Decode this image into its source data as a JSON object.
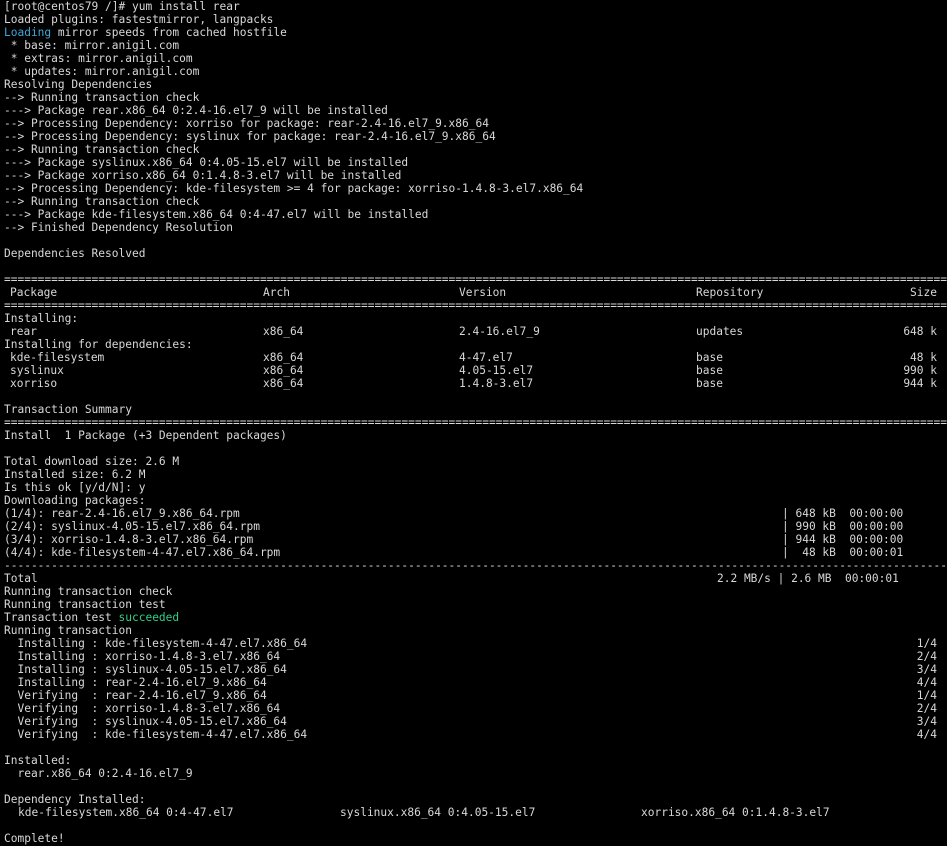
{
  "terminal": {
    "prompt": "[root@centos79 /]# yum install rear",
    "pre_lines": [
      "Loaded plugins: fastestmirror, langpacks"
    ],
    "loading_word": "Loading",
    "loading_rest": " mirror speeds from cached hostfile",
    "resolve_lines": [
      " * base: mirror.anigil.com",
      " * extras: mirror.anigil.com",
      " * updates: mirror.anigil.com",
      "Resolving Dependencies",
      "--> Running transaction check",
      "---> Package rear.x86_64 0:2.4-16.el7_9 will be installed",
      "--> Processing Dependency: xorriso for package: rear-2.4-16.el7_9.x86_64",
      "--> Processing Dependency: syslinux for package: rear-2.4-16.el7_9.x86_64",
      "--> Running transaction check",
      "---> Package syslinux.x86_64 0:4.05-15.el7 will be installed",
      "---> Package xorriso.x86_64 0:1.4.8-3.el7 will be installed",
      "--> Processing Dependency: kde-filesystem >= 4 for package: xorriso-1.4.8-3.el7.x86_64",
      "--> Running transaction check",
      "---> Package kde-filesystem.x86_64 0:4-47.el7 will be installed",
      "--> Finished Dependency Resolution",
      "",
      "Dependencies Resolved",
      ""
    ],
    "table_headers": {
      "package": "Package",
      "arch": "Arch",
      "version": "Version",
      "repository": "Repository",
      "size": "Size"
    },
    "installing_label": "Installing:",
    "installing_rows": [
      {
        "package": "rear",
        "arch": "x86_64",
        "version": "2.4-16.el7_9",
        "repository": "updates",
        "size": "648 k"
      }
    ],
    "deps_label": "Installing for dependencies:",
    "dep_rows": [
      {
        "package": "kde-filesystem",
        "arch": "x86_64",
        "version": "4-47.el7",
        "repository": "base",
        "size": "48 k"
      },
      {
        "package": "syslinux",
        "arch": "x86_64",
        "version": "4.05-15.el7",
        "repository": "base",
        "size": "990 k"
      },
      {
        "package": "xorriso",
        "arch": "x86_64",
        "version": "1.4.8-3.el7",
        "repository": "base",
        "size": "944 k"
      }
    ],
    "summary_title": "Transaction Summary",
    "summary_install": "Install  1 Package (+3 Dependent packages)",
    "totals_lines": [
      "",
      "Total download size: 2.6 M",
      "Installed size: 6.2 M",
      "Is this ok [y/d/N]: y",
      "Downloading packages:"
    ],
    "downloads": [
      {
        "name": "(1/4): rear-2.4-16.el7_9.x86_64.rpm",
        "stats": "| 648 kB  00:00:00"
      },
      {
        "name": "(2/4): syslinux-4.05-15.el7.x86_64.rpm",
        "stats": "| 990 kB  00:00:00"
      },
      {
        "name": "(3/4): xorriso-1.4.8-3.el7.x86_64.rpm",
        "stats": "| 944 kB  00:00:00"
      },
      {
        "name": "(4/4): kde-filesystem-4-47.el7.x86_64.rpm",
        "stats": "|  48 kB  00:00:01"
      }
    ],
    "total_label": "Total",
    "total_stats": "2.2 MB/s | 2.6 MB  00:00:01",
    "run_check": "Running transaction check",
    "run_test": "Running transaction test",
    "test_prefix": "Transaction test ",
    "test_result": "succeeded",
    "run_tx": "Running transaction",
    "steps": [
      {
        "action": "  Installing : kde-filesystem-4-47.el7.x86_64",
        "count": "1/4"
      },
      {
        "action": "  Installing : xorriso-1.4.8-3.el7.x86_64",
        "count": "2/4"
      },
      {
        "action": "  Installing : syslinux-4.05-15.el7.x86_64",
        "count": "3/4"
      },
      {
        "action": "  Installing : rear-2.4-16.el7_9.x86_64",
        "count": "4/4"
      },
      {
        "action": "  Verifying  : rear-2.4-16.el7_9.x86_64",
        "count": "1/4"
      },
      {
        "action": "  Verifying  : xorriso-1.4.8-3.el7.x86_64",
        "count": "2/4"
      },
      {
        "action": "  Verifying  : syslinux-4.05-15.el7.x86_64",
        "count": "3/4"
      },
      {
        "action": "  Verifying  : kde-filesystem-4-47.el7.x86_64",
        "count": "4/4"
      }
    ],
    "installed_label": "Installed:",
    "installed_pkg": "  rear.x86_64 0:2.4-16.el7_9",
    "dep_installed_label": "Dependency Installed:",
    "dep_installed": [
      "kde-filesystem.x86_64 0:4-47.el7",
      "syslinux.x86_64 0:4.05-15.el7",
      "xorriso.x86_64 0:1.4.8-3.el7"
    ],
    "complete": "Complete!"
  },
  "colors": {
    "background": "#000000",
    "text": "#d8d8d8",
    "loading": "#3fa7d6",
    "succeeded": "#2fd08a"
  }
}
